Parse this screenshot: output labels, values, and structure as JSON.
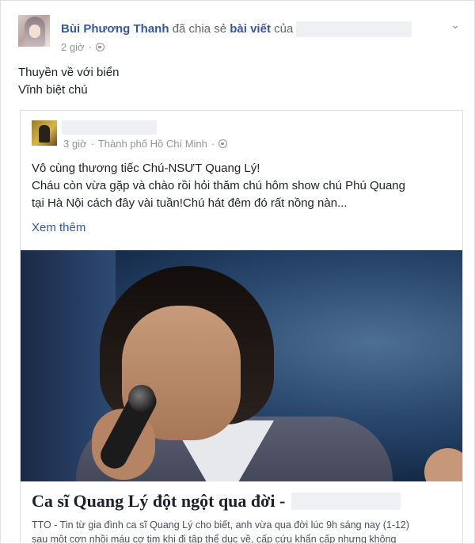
{
  "post": {
    "author": "Bùi Phương Thanh",
    "action": "đã chia sẻ",
    "object": "bài viết",
    "of_word": "của",
    "time": "2 giờ",
    "separator": "·",
    "message_lines": [
      "Thuyền về với biển",
      "Vĩnh biệt chú"
    ]
  },
  "shared_post": {
    "time": "3 giờ",
    "separator": "·",
    "location": "Thành phố Hồ Chí Minh",
    "location_separator": "·",
    "text_lines": [
      "Vô cùng thương tiếc Chú-NSƯT Quang Lý!",
      "Cháu còn vừa gặp và chào rồi hỏi thăm chú hôm show chú Phú Quang",
      "tại Hà Nội cách đây vài tuần!Chú hát đêm đó rất nồng nàn..."
    ],
    "see_more": "Xem thêm"
  },
  "link_preview": {
    "title": "Ca sĩ Quang Lý đột ngột qua đời -",
    "description_lines": [
      "TTO - Tin từ gia đình ca sĩ Quang Lý cho biết, anh vừa qua đời lúc 9h sáng nay (1-12)",
      "sau một cơn nhồi máu cơ tim khi đi tập thể dục về, cấp cứu khẩn cấp nhưng không"
    ]
  },
  "icons": {
    "globe": "globe-icon",
    "chevron": "chevron-down-icon"
  },
  "colors": {
    "link": "#365899",
    "text": "#1d2129",
    "meta": "#90949c",
    "border": "#dddfe2"
  }
}
